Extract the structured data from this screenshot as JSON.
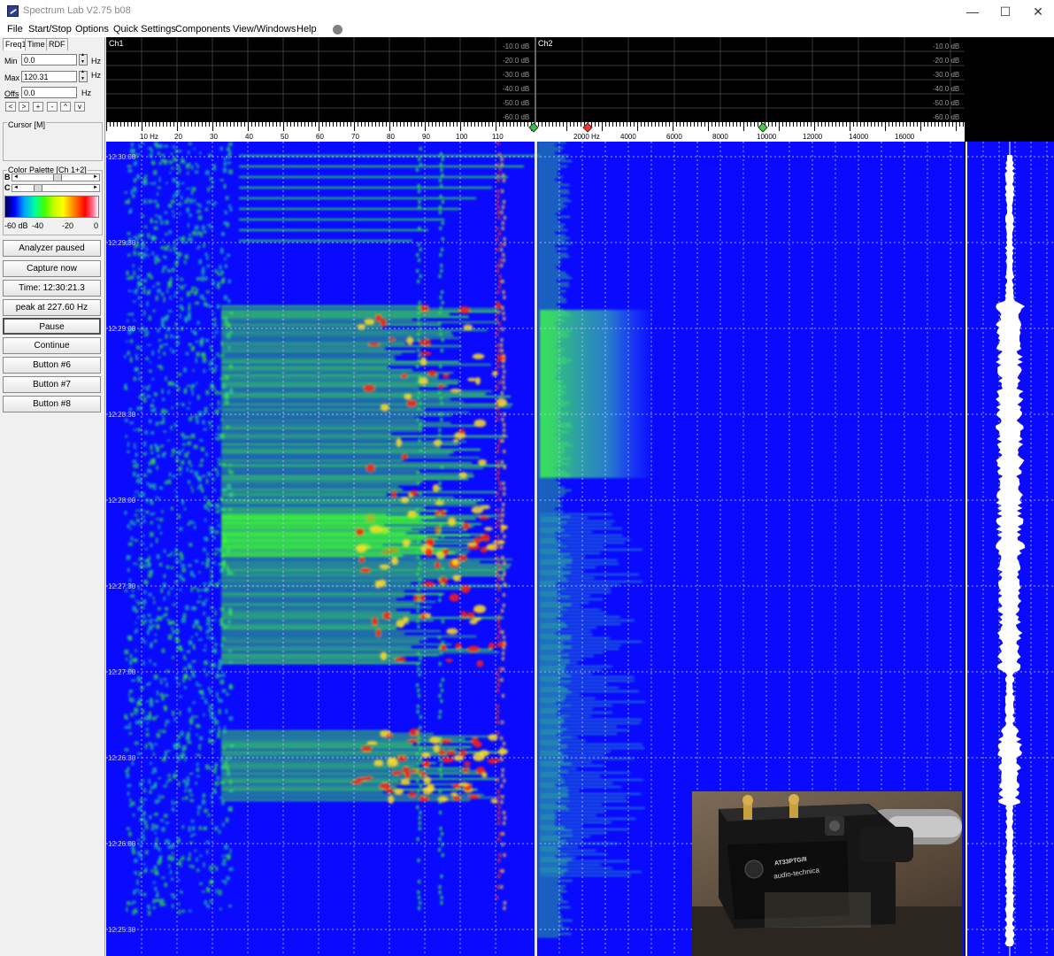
{
  "window": {
    "title": "Spectrum Lab V2.75 b08",
    "min_glyph": "—",
    "max_glyph": "☐",
    "close_glyph": "✕"
  },
  "menu": [
    {
      "label": "File"
    },
    {
      "label": "Start/Stop"
    },
    {
      "label": "Options"
    },
    {
      "label": "Quick Settings"
    },
    {
      "label": "Components"
    },
    {
      "label": "View/Windows"
    },
    {
      "label": "Help"
    }
  ],
  "left": {
    "tabs": [
      "Freq1",
      "Time",
      "RDF"
    ],
    "min_label": "Min",
    "min_value": "0.0",
    "max_label": "Max",
    "max_value": "120.31",
    "offs_label": "Offs",
    "offs_value": "0.0",
    "unit_hz": "Hz",
    "nav": [
      "<",
      ">",
      "+",
      "-",
      "^",
      "v"
    ],
    "cursor_title": "Cursor  [M]",
    "palette_title": "Color Palette [Ch 1+2]",
    "b_label": "B",
    "c_label": "C",
    "palette_labels": [
      "-60 dB",
      "-40",
      "-20",
      "0"
    ],
    "buttons": [
      {
        "label": "Analyzer paused"
      },
      {
        "label": "Capture now"
      },
      {
        "label": "Time:  12:30:21.3"
      },
      {
        "label": "peak at 227.60 Hz"
      },
      {
        "label": "Pause"
      },
      {
        "label": "Continue"
      },
      {
        "label": "Button #6"
      },
      {
        "label": "Button #7"
      },
      {
        "label": "Button #8"
      }
    ]
  },
  "display": {
    "ch1": "Ch1",
    "ch2": "Ch2",
    "db_ticks": [
      "-10.0 dB",
      "-20.0 dB",
      "-30.0 dB",
      "-40.0 dB",
      "-50.0 dB",
      "-60.0 dB"
    ],
    "ch1_freq_labels": [
      "10 Hz",
      "20",
      "30",
      "40",
      "50",
      "60",
      "70",
      "80",
      "90",
      "100",
      "110"
    ],
    "ch2_freq_labels": [
      "2000 Hz",
      "4000",
      "6000",
      "8000",
      "10000",
      "12000",
      "14000",
      "16000"
    ],
    "time_labels": [
      "12:30:00",
      "12:29:30",
      "12:29:00",
      "12:28:30",
      "12:28:00",
      "12:27:30",
      "12:27:00",
      "12:26:30",
      "12:26:00",
      "12:25:30"
    ]
  },
  "photo": {
    "model_text": "AT33PTG/II",
    "brand_text": "audio-technica"
  }
}
